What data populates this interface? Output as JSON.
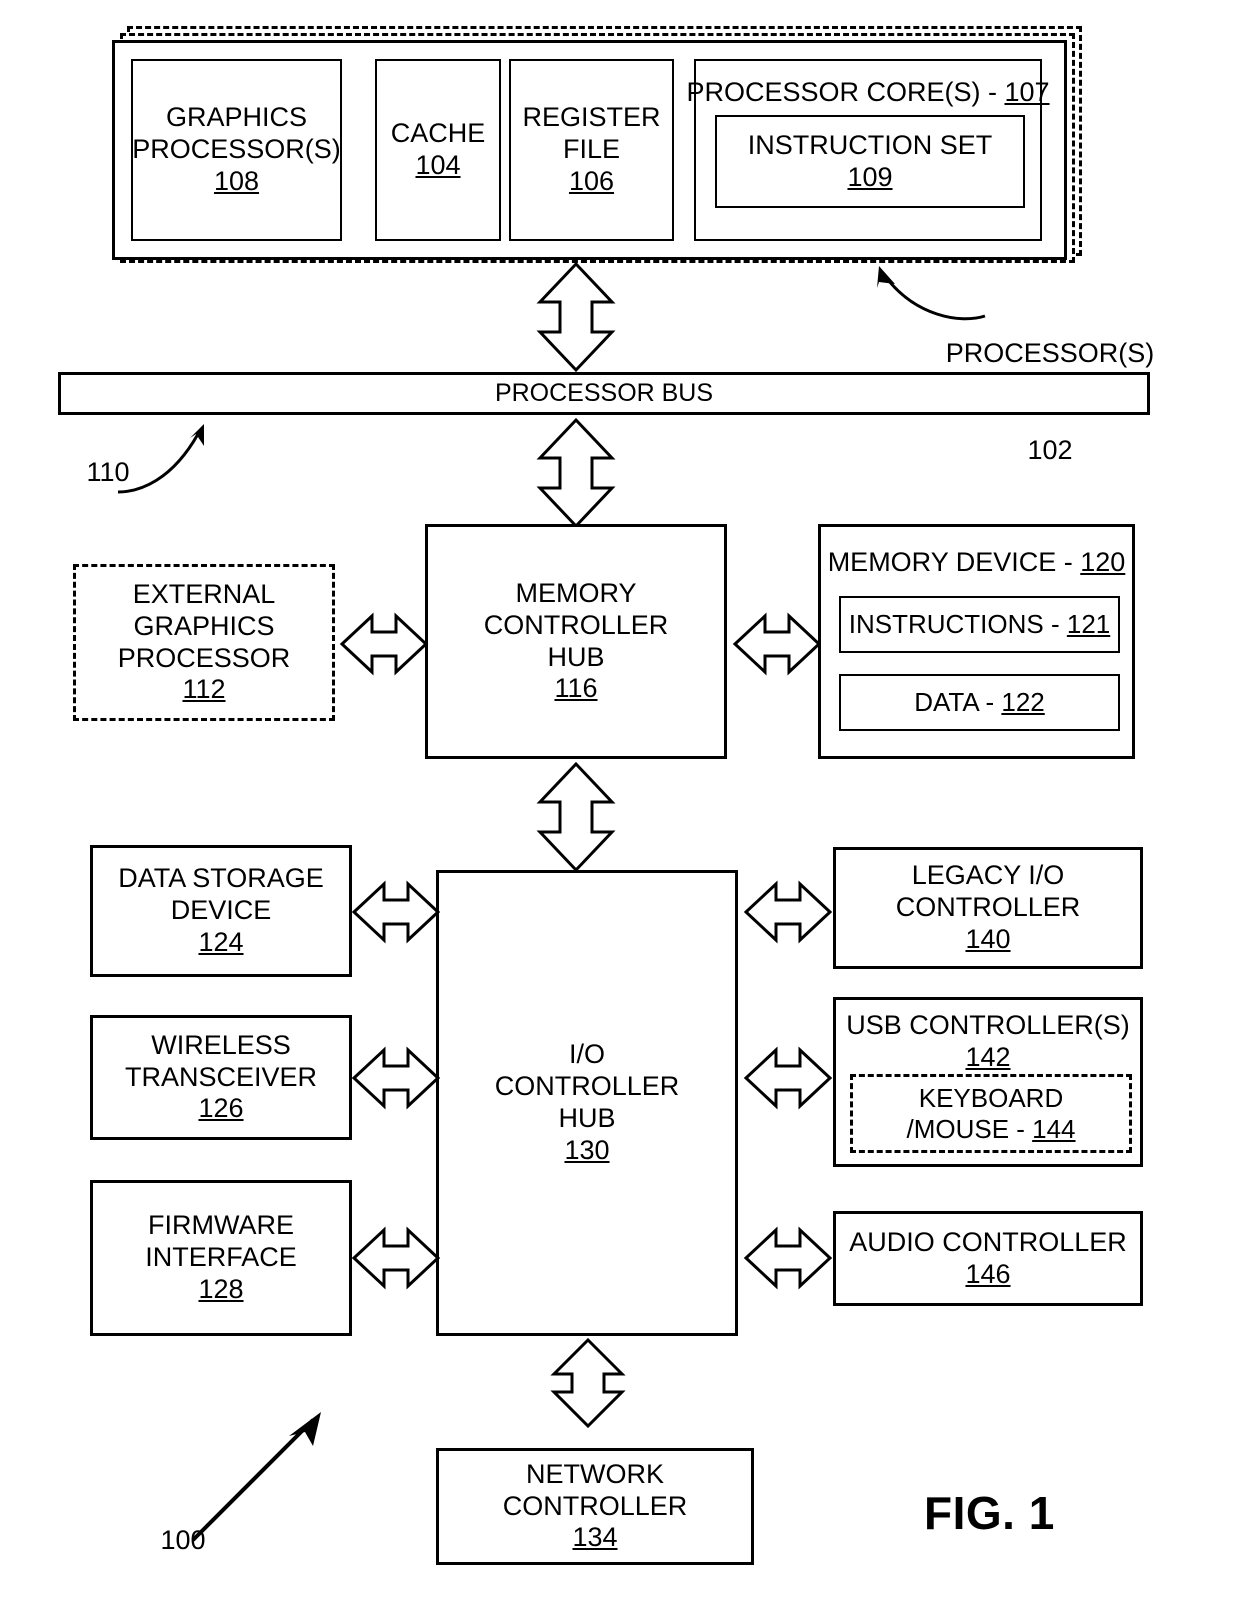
{
  "figure": {
    "label": "FIG. 1",
    "system_ref": "100"
  },
  "processor_group": {
    "callout_label": "PROCESSOR(S)",
    "callout_ref": "102",
    "blocks": [
      {
        "id": "graphics-processors",
        "line1": "GRAPHICS",
        "line2": "PROCESSOR(S)",
        "ref": "108"
      },
      {
        "id": "cache",
        "line1": "CACHE",
        "ref": "104"
      },
      {
        "id": "register-file",
        "line1": "REGISTER",
        "line2": "FILE",
        "ref": "106"
      },
      {
        "id": "processor-cores",
        "title": "PROCESSOR CORE(S) - ",
        "ref": "107"
      }
    ],
    "instruction_set": {
      "line1": "INSTRUCTION SET",
      "ref": "109"
    }
  },
  "processor_bus": {
    "label": "PROCESSOR BUS",
    "ref": "110"
  },
  "external_graphics": {
    "line1": "EXTERNAL",
    "line2": "GRAPHICS",
    "line3": "PROCESSOR",
    "ref": "112"
  },
  "memory_controller_hub": {
    "line1": "MEMORY",
    "line2": "CONTROLLER",
    "line3": "HUB",
    "ref": "116"
  },
  "memory_device": {
    "title": "MEMORY DEVICE - ",
    "ref": "120",
    "instructions": {
      "label": "INSTRUCTIONS - ",
      "ref": "121"
    },
    "data": {
      "label": "DATA - ",
      "ref": "122"
    }
  },
  "io_controller_hub": {
    "line1": "I/O",
    "line2": "CONTROLLER",
    "line3": "HUB",
    "ref": "130"
  },
  "left_peripherals": [
    {
      "id": "data-storage-device",
      "line1": "DATA STORAGE",
      "line2": "DEVICE",
      "ref": "124"
    },
    {
      "id": "wireless-transceiver",
      "line1": "WIRELESS",
      "line2": "TRANSCEIVER",
      "ref": "126"
    },
    {
      "id": "firmware-interface",
      "line1": "FIRMWARE",
      "line2": "INTERFACE",
      "ref": "128"
    }
  ],
  "right_peripherals": [
    {
      "id": "legacy-io-controller",
      "line1": "LEGACY I/O",
      "line2": "CONTROLLER",
      "ref": "140"
    },
    {
      "id": "usb-controllers",
      "line1": "USB CONTROLLER(S)",
      "ref": "142"
    },
    {
      "id": "audio-controller",
      "line1": "AUDIO CONTROLLER",
      "ref": "146"
    }
  ],
  "keyboard_mouse": {
    "line1": "KEYBOARD",
    "line2": "/MOUSE - ",
    "ref": "144"
  },
  "network_controller": {
    "line1": "NETWORK",
    "line2": "CONTROLLER",
    "ref": "134"
  },
  "colors": {
    "stroke": "#000000",
    "background": "#ffffff"
  }
}
